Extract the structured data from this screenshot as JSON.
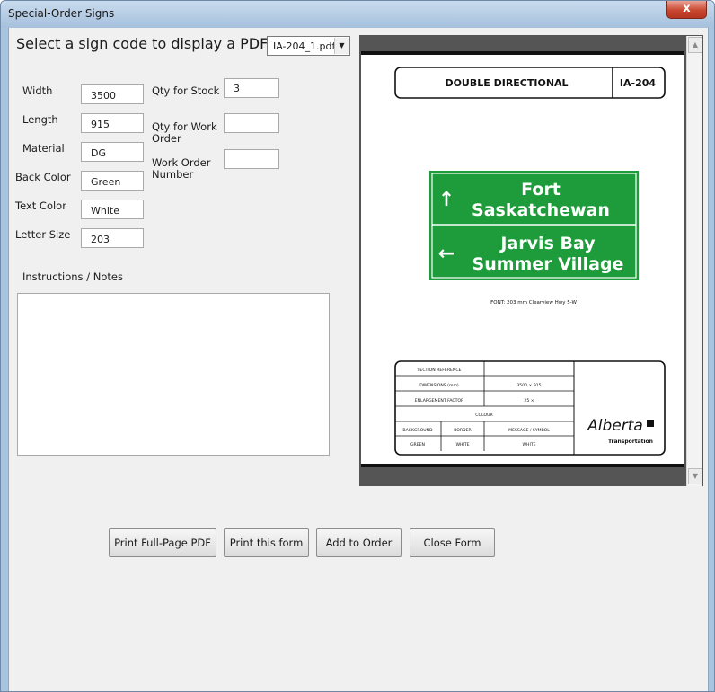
{
  "window": {
    "title": "Special-Order Signs",
    "close_glyph": "x"
  },
  "prompt": "Select a sign code to display a PDF:",
  "pdf_select": {
    "value": "IA-204_1.pdf",
    "arrow": "▼"
  },
  "fields": {
    "width": {
      "label": "Width",
      "value": "3500"
    },
    "length": {
      "label": "Length",
      "value": "915"
    },
    "material": {
      "label": "Material",
      "value": "DG"
    },
    "back_color": {
      "label": "Back Color",
      "value": "Green"
    },
    "text_color": {
      "label": "Text Color",
      "value": "White"
    },
    "letter_size": {
      "label": "Letter Size",
      "value": "203"
    },
    "qty_stock": {
      "label": "Qty for Stock",
      "value": "3"
    },
    "qty_work_order": {
      "label_line1": "Qty for Work",
      "label_line2": "Order",
      "value": ""
    },
    "work_order_number": {
      "label_line1": "Work Order",
      "label_line2": "Number",
      "value": ""
    }
  },
  "notes_label": "Instructions / Notes",
  "notes_value": "",
  "buttons": {
    "print_full_page": "Print Full-Page PDF",
    "print_form": "Print this form",
    "add_to_order": "Add to Order",
    "close_form": "Close Form"
  },
  "scroll_icons": {
    "up": "▲",
    "down": "▼"
  },
  "sign": {
    "header_title": "DOUBLE DIRECTIONAL",
    "code": "IA-204",
    "panel1_line1": "Fort",
    "panel1_line2": "Saskatchewan",
    "panel2_line1": "Jarvis  Bay",
    "panel2_line2": "Summer Village",
    "font_note": "FONT: 203  mm  Clearview Hwy 5-W",
    "arrow_up": "↑",
    "arrow_left": "←",
    "table": {
      "section_reference": "SECTION  REFERENCE",
      "section_reference_value": "",
      "dimensions_label": "DIMENSIONS  (mm)",
      "dimensions_value": "3500  ×  915",
      "enlargement_label": "ENLARGEMENT  FACTOR",
      "enlargement_value": "25  ×",
      "colour_label": "COLOUR",
      "col_background": "BACKGROUND",
      "col_border": "BORDER",
      "col_message": "MESSAGE  /  SYMBOL",
      "val_background": "GREEN",
      "val_border": "WHITE",
      "val_message": "WHITE"
    },
    "logo_text": "Alberta",
    "logo_sub": "Transportation",
    "sign_green": "#1e9b3a"
  },
  "colors": {
    "title_bar": "#a6c0dc",
    "close_red": "#c9472f",
    "form_bg": "#f0f0f0",
    "viewer_bg": "#555555"
  }
}
